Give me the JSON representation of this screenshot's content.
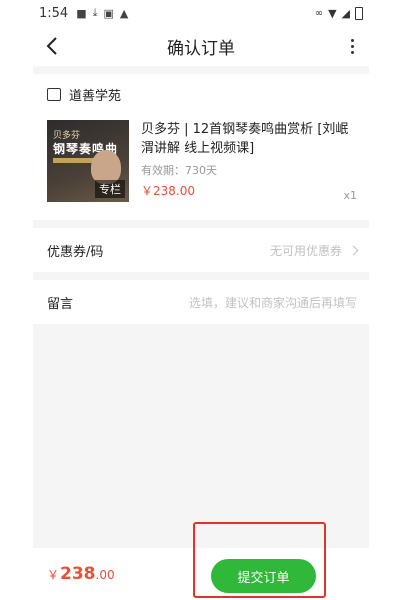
{
  "status_bar": {
    "time": "1:54"
  },
  "header": {
    "title": "确认订单"
  },
  "shop": {
    "name": "道善学苑"
  },
  "product": {
    "name": "贝多芬 | 12首钢琴奏鸣曲赏析 [刘岷渭讲解 线上视频课]",
    "validity": "有效期：730天",
    "price": "￥238.00",
    "quantity": "x1",
    "thumbnail": {
      "line1": "贝多芬",
      "line2": "钢琴奏鸣曲",
      "tag": "专栏"
    }
  },
  "coupon": {
    "label": "优惠券/码",
    "value": "无可用优惠券"
  },
  "message": {
    "label": "留言",
    "placeholder": "选填，建议和商家沟通后再填写"
  },
  "footer": {
    "currency": "￥",
    "total_int": "238",
    "total_dec": ".00",
    "submit_label": "提交订单"
  },
  "colors": {
    "accent_green": "#2fb83a",
    "price_red": "#e8503a",
    "highlight_red": "#e0342b"
  }
}
